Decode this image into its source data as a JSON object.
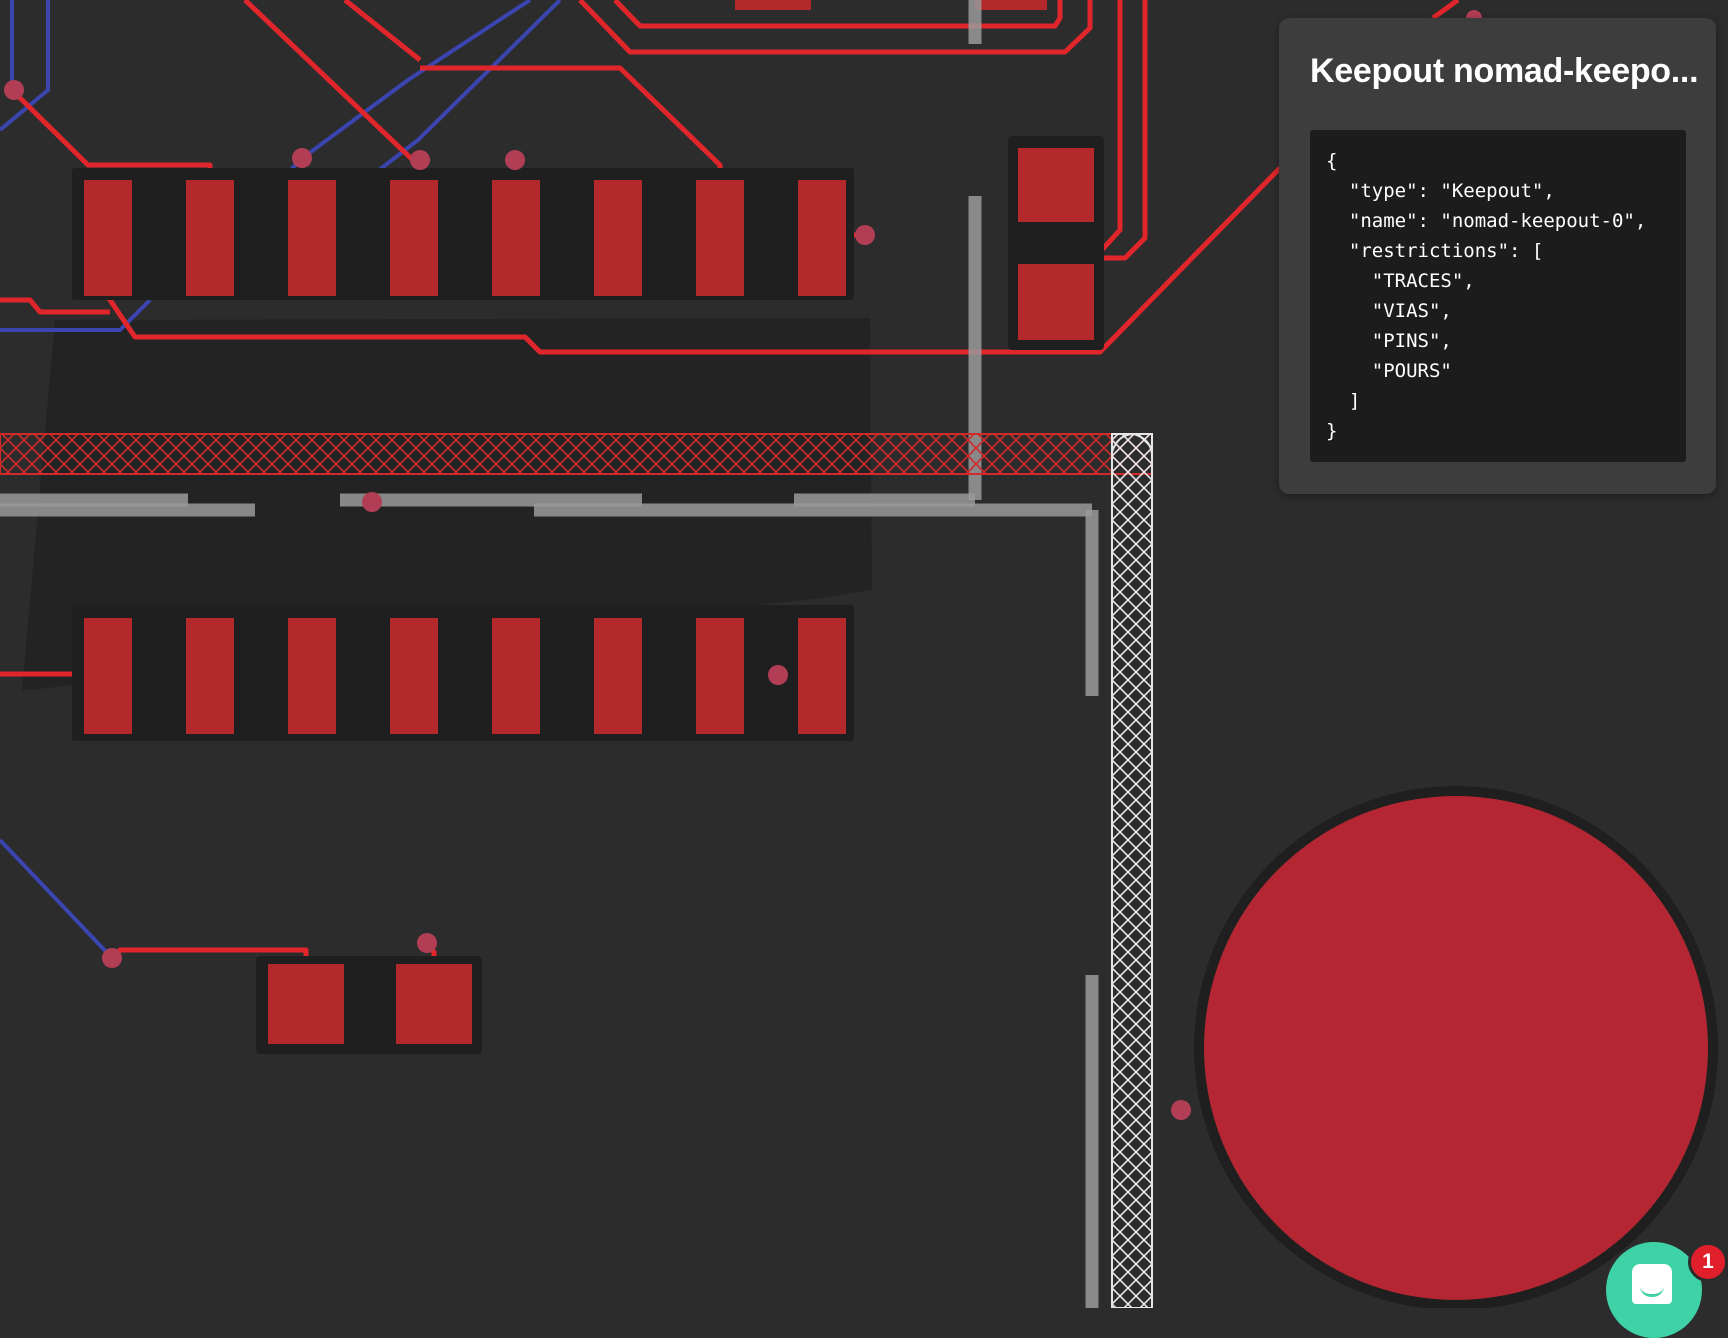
{
  "tooltip": {
    "title": "Keepout nomad-keepo...",
    "json_text": "{\n  \"type\": \"Keepout\",\n  \"name\": \"nomad-keepout-0\",\n  \"restrictions\": [\n    \"TRACES\",\n    \"VIAS\",\n    \"PINS\",\n    \"POURS\"\n  ]\n}"
  },
  "chat": {
    "badge_count": "1",
    "icon": "chat-bubble-icon"
  },
  "colors": {
    "background": "#2c2c2d",
    "trace_top": "#e0262b",
    "trace_bottom": "#3b45b0",
    "pad": "#b2282b",
    "silkscreen": "#9a9a9a",
    "keepout": "#d22a2a",
    "chat_accent": "#3fd2a7",
    "badge": "#e01f2a"
  }
}
